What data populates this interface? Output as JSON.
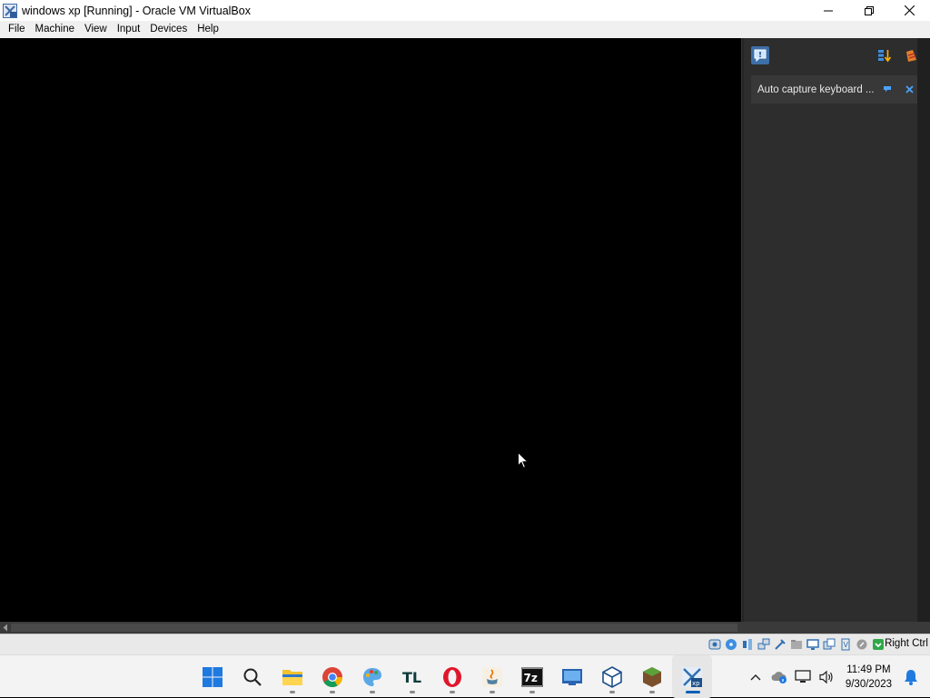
{
  "window": {
    "title": "windows xp [Running] - Oracle VM VirtualBox"
  },
  "menu": {
    "items": [
      "File",
      "Machine",
      "View",
      "Input",
      "Devices",
      "Help"
    ]
  },
  "notification": {
    "text": "Auto capture keyboard ..."
  },
  "statusbar": {
    "host_key": "Right Ctrl",
    "icons": [
      "hard-disk-icon",
      "optical-disk-icon",
      "audio-icon",
      "network-icon",
      "usb-icon",
      "shared-folders-icon",
      "display-icon",
      "recording-icon",
      "cpu-virtualization-icon",
      "mouse-integration-icon",
      "keyboard-capture-icon"
    ]
  },
  "taskbar": {
    "apps": [
      "start-icon",
      "search-icon",
      "file-explorer-icon",
      "chrome-icon",
      "paint-icon",
      "tlauncher-icon",
      "opera-icon",
      "java-icon",
      "7zip-icon",
      "remote-desktop-icon",
      "virtualbox-icon",
      "minecraft-icon",
      "vm-xp-icon"
    ],
    "time": "11:49 PM",
    "date": "9/30/2023"
  },
  "colors": {
    "vm_background": "#000000",
    "panel": "#2d2d2d",
    "accent": "#005fb8"
  }
}
